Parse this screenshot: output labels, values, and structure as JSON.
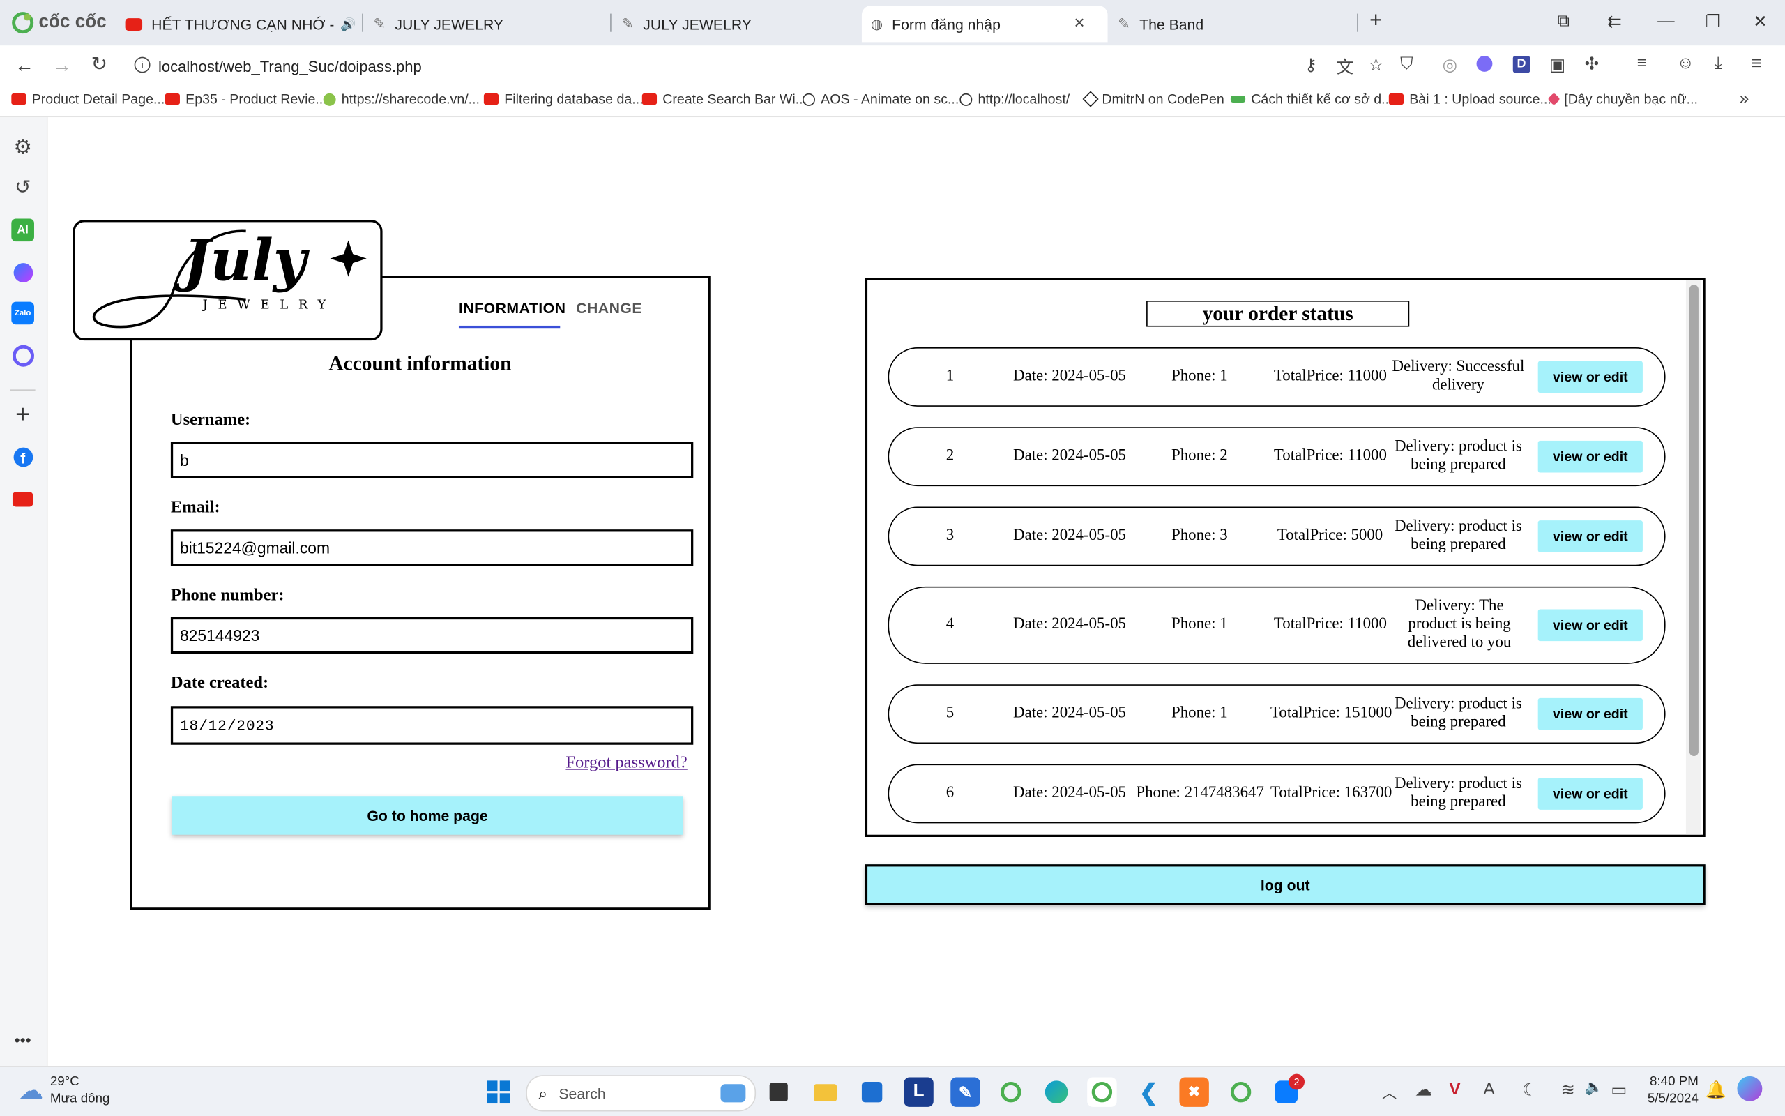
{
  "browser": {
    "brand": "cốc cốc",
    "tabs": [
      {
        "title": "HẾT THƯƠNG CẠN NHỚ - ĐỨ"
      },
      {
        "title": "JULY JEWELRY"
      },
      {
        "title": "JULY JEWELRY"
      },
      {
        "title": "Form đăng nhập"
      },
      {
        "title": "The Band"
      }
    ],
    "url": "localhost/web_Trang_Suc/doipass.php",
    "bookmarks": [
      "Product Detail Page...",
      "Ep35 - Product Revie...",
      "https://sharecode.vn/...",
      "Filtering database da...",
      "Create Search Bar Wi...",
      "AOS - Animate on sc...",
      "http://localhost/",
      "DmitrN on CodePen",
      "Cách thiết kế cơ sở d...",
      "Bài 1 : Upload source...",
      "[Dây chuyền bạc nữ..."
    ]
  },
  "sidebar": {
    "ai_label": "AI",
    "zalo_label": "Zalo"
  },
  "account": {
    "logo_text": "July",
    "logo_subtext": "JEWELRY",
    "tab_information": "INFORMATION",
    "tab_change": "CHANGE",
    "heading": "Account information",
    "username_label": "Username:",
    "username_value": "b",
    "email_label": "Email:",
    "email_value": "bit15224@gmail.com",
    "phone_label": "Phone number:",
    "phone_value": "825144923",
    "date_label": "Date created:",
    "date_value": "18/12/2023",
    "forgot_link": "Forgot password?",
    "home_button": "Go to home page"
  },
  "orders": {
    "title": "your order status",
    "button_label": "view or edit",
    "logout_label": "log out",
    "items": [
      {
        "id": "1",
        "date": "Date: 2024-05-05",
        "phone": "Phone: 1",
        "total": "TotalPrice: 11000",
        "delivery": "Delivery: Successful delivery"
      },
      {
        "id": "2",
        "date": "Date: 2024-05-05",
        "phone": "Phone: 2",
        "total": "TotalPrice: 11000",
        "delivery": "Delivery: product is being prepared"
      },
      {
        "id": "3",
        "date": "Date: 2024-05-05",
        "phone": "Phone: 3",
        "total": "TotalPrice: 5000",
        "delivery": "Delivery: product is being prepared"
      },
      {
        "id": "4",
        "date": "Date: 2024-05-05",
        "phone": "Phone: 1",
        "total": "TotalPrice: 11000",
        "delivery": "Delivery: The product is being delivered to you"
      },
      {
        "id": "5",
        "date": "Date: 2024-05-05",
        "phone": "Phone: 1",
        "total": "TotalPrice: 151000",
        "delivery": "Delivery: product is being prepared"
      },
      {
        "id": "6",
        "date": "Date: 2024-05-05",
        "phone": "Phone: 2147483647",
        "total": "TotalPrice: 163700",
        "delivery": "Delivery: product is being prepared"
      }
    ]
  },
  "taskbar": {
    "temperature": "29°C",
    "weather": "Mưa dông",
    "search_label": "Search",
    "time": "8:40 PM",
    "date": "5/5/2024",
    "badge_count": "2",
    "letter_app": "L"
  },
  "colors": {
    "accent_button": "#a6f2fb",
    "tab_underline": "#3b4fd8",
    "link": "#551a8b"
  }
}
